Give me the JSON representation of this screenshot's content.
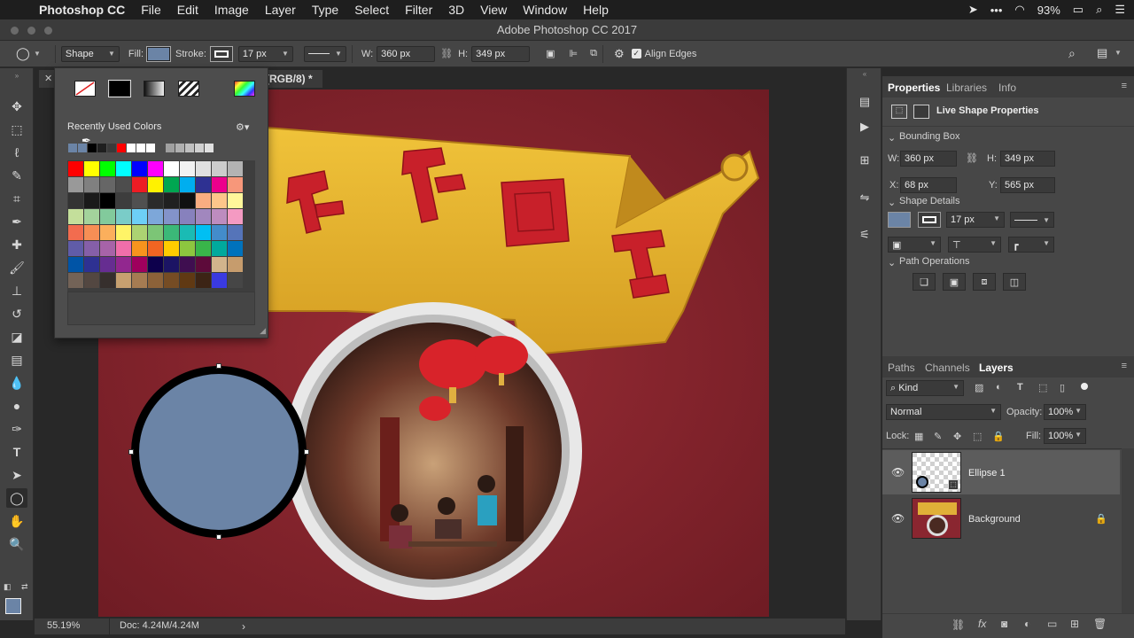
{
  "menubar": {
    "app_name": "Photoshop CC",
    "items": [
      "File",
      "Edit",
      "Image",
      "Layer",
      "Type",
      "Select",
      "Filter",
      "3D",
      "View",
      "Window",
      "Help"
    ],
    "battery": "93%"
  },
  "window": {
    "title": "Adobe Photoshop CC 2017"
  },
  "options": {
    "mode": "Shape",
    "fill_label": "Fill:",
    "stroke_label": "Stroke:",
    "stroke_width": "17 px",
    "w_label": "W:",
    "w_value": "360 px",
    "h_label": "H:",
    "h_value": "349 px",
    "align_edges": "Align Edges"
  },
  "document": {
    "tab_suffix": "(RGB/8) *"
  },
  "swatch_popup": {
    "recent_label": "Recently Used Colors",
    "recent_colors": [
      "#6b84a6",
      "#6b84a6",
      "#000000",
      "#1f1f1f",
      "#3a3a3a",
      "#ff0000",
      "#ffffff",
      "#ffffff",
      "#ffffff",
      "#4d4d4d",
      "#a0a0a0",
      "#b0b0b0",
      "#c0c0c0",
      "#d0d0d0",
      "#e0e0e0"
    ],
    "grid_colors": [
      "#ff0000",
      "#ffff00",
      "#00ff00",
      "#00ffff",
      "#0000ff",
      "#ff00ff",
      "#ffffff",
      "#f2f2f2",
      "#e0e0e0",
      "#cccccc",
      "#b3b3b3",
      "#999999",
      "#808080",
      "#666666",
      "#4d4d4d",
      "#ed1c24",
      "#fff200",
      "#00a651",
      "#00aeef",
      "#2e3192",
      "#ec008c",
      "#f7977a",
      "#333333",
      "#1a1a1a",
      "#000000",
      "#3d3d3d",
      "#505050",
      "#2b2b2b",
      "#202020",
      "#101010",
      "#f9ad81",
      "#fdc68a",
      "#fff79a",
      "#c4df9b",
      "#a3d39c",
      "#82ca9c",
      "#7accc8",
      "#6dcff6",
      "#7da7d9",
      "#8393ca",
      "#8781bd",
      "#a187be",
      "#bd8cbf",
      "#f49ac2",
      "#f26c4f",
      "#f68e55",
      "#fbaf5c",
      "#fff467",
      "#acd372",
      "#7cc576",
      "#3bb878",
      "#1abbb4",
      "#00bff3",
      "#438ccb",
      "#5574b9",
      "#605ca8",
      "#855fa8",
      "#a763a8",
      "#f06eaa",
      "#f7941d",
      "#f26522",
      "#ffcc00",
      "#8dc63f",
      "#39b54a",
      "#00a99d",
      "#0072bc",
      "#0054a6",
      "#2e3192",
      "#662d91",
      "#92278f",
      "#9e005d",
      "#0d004c",
      "#1b1464",
      "#3f0e50",
      "#5d0a3a",
      "#d2b48c",
      "#c69c6d",
      "#736357",
      "#534741",
      "#362f2d",
      "#c7a070",
      "#a67c52",
      "#8c6239",
      "#754c24",
      "#603913",
      "#3c2415",
      "#3a3ae0",
      "#464646"
    ]
  },
  "status": {
    "zoom": "55.19%",
    "doc": "Doc: 4.24M/4.24M"
  },
  "properties": {
    "tabs": [
      "Properties",
      "Libraries",
      "Info"
    ],
    "header": "Live Shape Properties",
    "bounding_box": "Bounding Box",
    "w_label": "W:",
    "w_value": "360 px",
    "h_label": "H:",
    "h_value": "349 px",
    "x_label": "X:",
    "x_value": "68 px",
    "y_label": "Y:",
    "y_value": "565 px",
    "shape_details": "Shape Details",
    "stroke_width": "17 px",
    "path_operations": "Path Operations"
  },
  "layers_panel": {
    "tabs": [
      "Paths",
      "Channels",
      "Layers"
    ],
    "filter": "Kind",
    "blend_mode": "Normal",
    "opacity_label": "Opacity:",
    "opacity": "100%",
    "lock_label": "Lock:",
    "fill_label": "Fill:",
    "fill": "100%",
    "layers": [
      {
        "name": "Ellipse 1"
      },
      {
        "name": "Background"
      }
    ]
  },
  "colors": {
    "fill": "#6b84a6",
    "stroke": "#000000",
    "accent": "#2d8ceb"
  }
}
